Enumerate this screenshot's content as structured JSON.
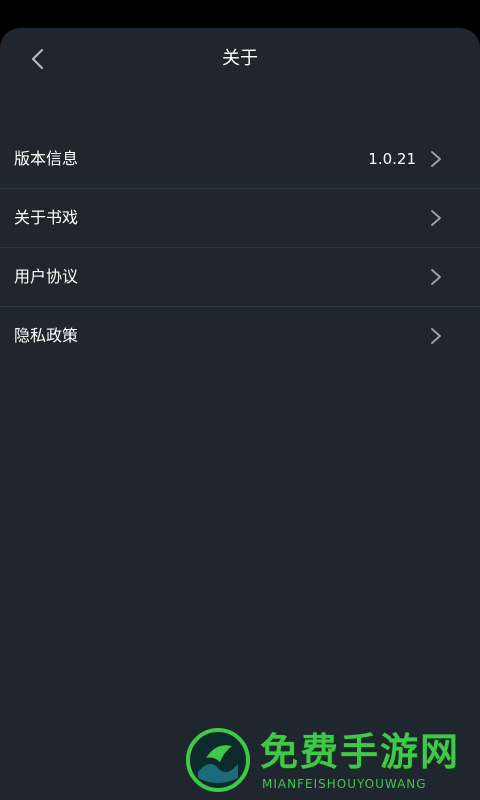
{
  "header": {
    "title": "关于",
    "back_icon": "chevron-left-icon"
  },
  "items": [
    {
      "label": "版本信息",
      "value": "1.0.21",
      "icon": "chevron-right-icon"
    },
    {
      "label": "关于书戏",
      "value": "",
      "icon": "chevron-right-icon"
    },
    {
      "label": "用户协议",
      "value": "",
      "icon": "chevron-right-icon"
    },
    {
      "label": "隐私政策",
      "value": "",
      "icon": "chevron-right-icon"
    }
  ],
  "watermark": {
    "title": "免费手游网",
    "subtitle": "MIANFEISHOUYOUWANG"
  },
  "colors": {
    "background": "#1f262d",
    "divider": "#2d353d",
    "text": "#ffffff",
    "icon": "#9aa0a6",
    "watermark": "#3fc84a"
  }
}
